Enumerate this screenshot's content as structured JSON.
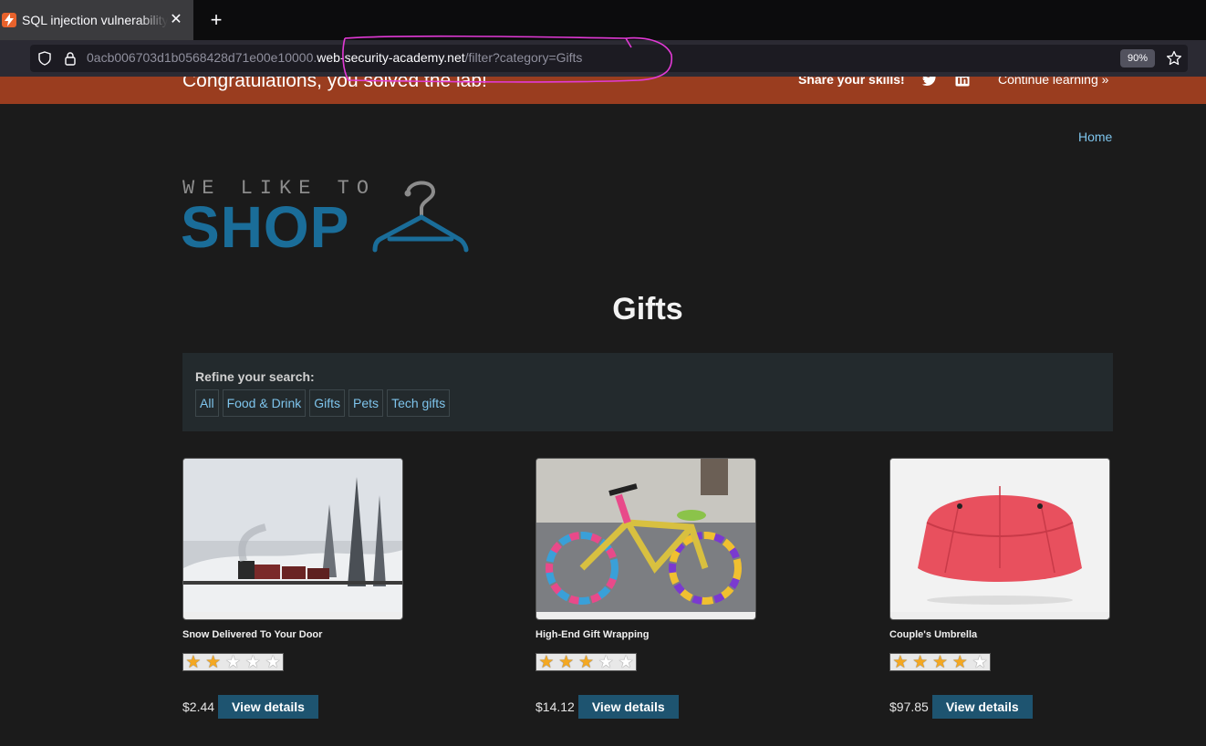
{
  "browser": {
    "tab_title": "SQL injection vulnerability",
    "url_prefix": "0acb006703d1b0568428d71e00e10000.",
    "url_host": "web-security-academy.net",
    "url_path": "/filter?category=Gifts",
    "zoom": "90%"
  },
  "banner": {
    "message": "Congratulations, you solved the lab!",
    "share": "Share your skills!",
    "continue": "Continue learning »"
  },
  "nav": {
    "home": "Home"
  },
  "logo": {
    "top": "WE LIKE TO",
    "main": "SHOP"
  },
  "page": {
    "heading": "Gifts"
  },
  "refine": {
    "label": "Refine your search:",
    "filters": [
      "All",
      "Food & Drink",
      "Gifts",
      "Pets",
      "Tech gifts"
    ]
  },
  "products": [
    {
      "name": "Snow Delivered To Your Door",
      "price": "$2.44",
      "rating": 2,
      "button": "View details"
    },
    {
      "name": "High-End Gift Wrapping",
      "price": "$14.12",
      "rating": 3,
      "button": "View details"
    },
    {
      "name": "Couple's Umbrella",
      "price": "$97.85",
      "rating": 4,
      "button": "View details"
    }
  ],
  "colors": {
    "banner_bg": "#9a3d1f",
    "page_bg": "#1b1b1b",
    "link": "#7ec4ec",
    "button_bg": "#1e5470",
    "logo_blue": "#1a6d99",
    "annotation_pink": "#e23ad6"
  },
  "icons": [
    "portswigger-favicon",
    "close-icon",
    "plus-icon",
    "shield-icon",
    "lock-icon",
    "bookmark-star-icon",
    "twitter-icon",
    "linkedin-icon",
    "hanger-icon",
    "star-icon"
  ]
}
